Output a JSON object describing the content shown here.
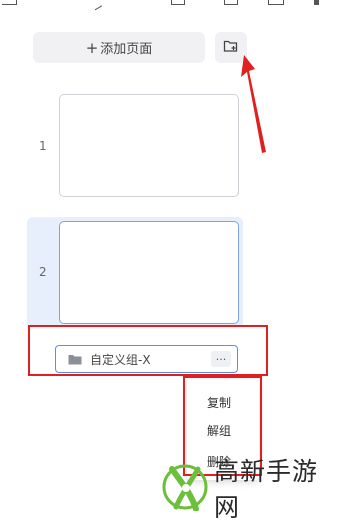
{
  "toolbar": {
    "add_page_plus": "+",
    "add_page_label": "添加页面"
  },
  "pages": [
    {
      "number": "1"
    },
    {
      "number": "2"
    }
  ],
  "group": {
    "name": "自定义组-X",
    "more_label": "···"
  },
  "context_menu": {
    "items": [
      "复制",
      "解组",
      "删除"
    ]
  },
  "watermark": {
    "text": "高新手游网"
  },
  "colors": {
    "accent_blue": "#5b8def",
    "highlight_red": "#e02020",
    "selected_bg": "#e8effc",
    "logo_green": "#6bbf3a"
  }
}
